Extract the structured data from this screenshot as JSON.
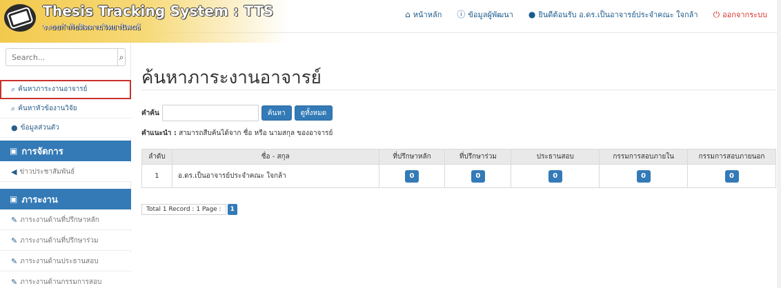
{
  "brand": {
    "title": "Thesis Tracking System : TTS",
    "subtitle": "ระบบกำกับติดตามวิทยานิพนธ์"
  },
  "topnav": {
    "home": "หน้าหลัก",
    "developer": "ข้อมูลผู้พัฒนา",
    "welcome": "ยินดีต้อนรับ อ.ดร.เป็นอาจารย์ประจำคณะ ใจกล้า",
    "logout": "ออกจากระบบ"
  },
  "sidebar": {
    "search_placeholder": "Search...",
    "items_top": [
      {
        "label": "ค้นหาภาระงานอาจารย์"
      },
      {
        "label": "ค้นหาหัวข้องานวิจัย"
      },
      {
        "label": "ข้อมูลส่วนตัว"
      }
    ],
    "section_manage": "การจัดการ",
    "manage_items": [
      {
        "label": "ข่าวประชาสัมพันธ์"
      }
    ],
    "section_report": "ภาระงาน",
    "report_items": [
      {
        "label": "ภาระงานด้านที่ปรึกษาหลัก"
      },
      {
        "label": "ภาระงานด้านที่ปรึกษาร่วม"
      },
      {
        "label": "ภาระงานด้านประธานสอบ"
      },
      {
        "label": "ภาระงานด้านกรรมการสอบ"
      }
    ]
  },
  "main": {
    "page_title": "ค้นหาภาระงานอาจารย์",
    "keyword_label": "คำค้น",
    "search_button": "ค้นหา",
    "show_all_button": "ดูทั้งหมด",
    "hint_label": "คำแนะนำ :",
    "hint_text": " สามารถสืบค้นได้จาก ชื่อ หรือ นามสกุล ของอาจารย์",
    "table": {
      "headers": [
        "ลำดับ",
        "ชื่อ - สกุล",
        "ที่ปรึกษาหลัก",
        "ที่ปรึกษาร่วม",
        "ประธานสอบ",
        "กรรมการสอบภายใน",
        "กรรมการสอบภายนอก"
      ],
      "rows": [
        {
          "no": "1",
          "name": "อ.ดร.เป็นอาจารย์ประจำคณะ ใจกล้า",
          "main_advisor": "0",
          "co_advisor": "0",
          "chair": "0",
          "internal": "0",
          "external": "0"
        }
      ]
    },
    "pager": {
      "info": "Total 1 Record : 1 Page :",
      "current": "1"
    }
  }
}
